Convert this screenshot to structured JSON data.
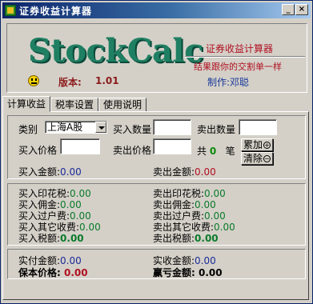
{
  "window": {
    "title": "证券收益计算器",
    "min_glyph": "_",
    "close_glyph": "×"
  },
  "header": {
    "logo": "StockCalc",
    "version_label": "版本:",
    "version": "1.01",
    "app_name": "证券收益计算器",
    "slogan": "结果跟你的交割单一样",
    "author": "制作:邓聪"
  },
  "tabs": [
    {
      "label": "计算收益",
      "active": true
    },
    {
      "label": "税率设置",
      "active": false
    },
    {
      "label": "使用说明",
      "active": false
    }
  ],
  "form": {
    "category_label": "类别",
    "category_value": "上海A股",
    "buy_qty_label": "买入数量",
    "sell_qty_label": "卖出数量",
    "buy_price_label": "买入价格",
    "sell_price_label": "卖出价格",
    "total_prefix": "共",
    "total_count": "0",
    "total_suffix": "笔",
    "add_button": "累加",
    "add_icon": "+",
    "clear_button": "清除",
    "clear_icon": "−",
    "buy_amount_label": "买入金额:",
    "buy_amount_value": "0.00",
    "sell_amount_label": "卖出金额:",
    "sell_amount_value": "0.00"
  },
  "fees": {
    "buy": [
      {
        "label": "买入印花税:",
        "value": "0.00"
      },
      {
        "label": "买入佣金:",
        "value": "0.00"
      },
      {
        "label": "买入过户费:",
        "value": "0.00"
      },
      {
        "label": "买入其它收费:",
        "value": "0.00"
      },
      {
        "label": "买入税额:",
        "value": "0.00"
      }
    ],
    "sell": [
      {
        "label": "卖出印花税:",
        "value": "0.00"
      },
      {
        "label": "卖出佣金:",
        "value": "0.00"
      },
      {
        "label": "卖出过户费:",
        "value": "0.00"
      },
      {
        "label": "卖出其它收费:",
        "value": "0.00"
      },
      {
        "label": "卖出税额:",
        "value": "0.00"
      }
    ]
  },
  "summary": {
    "paid_label": "实付金额:",
    "paid_value": "0.00",
    "received_label": "实收金额:",
    "received_value": "0.00",
    "breakeven_label": "保本价格:",
    "breakeven_value": "0.00",
    "profit_label": "赢亏金额:",
    "profit_value": "0.00"
  },
  "colors": {
    "accent_blue": "#1a2a9a",
    "accent_red": "#b01020",
    "accent_green": "#0a7a2a",
    "logo": "#1f7f62"
  }
}
